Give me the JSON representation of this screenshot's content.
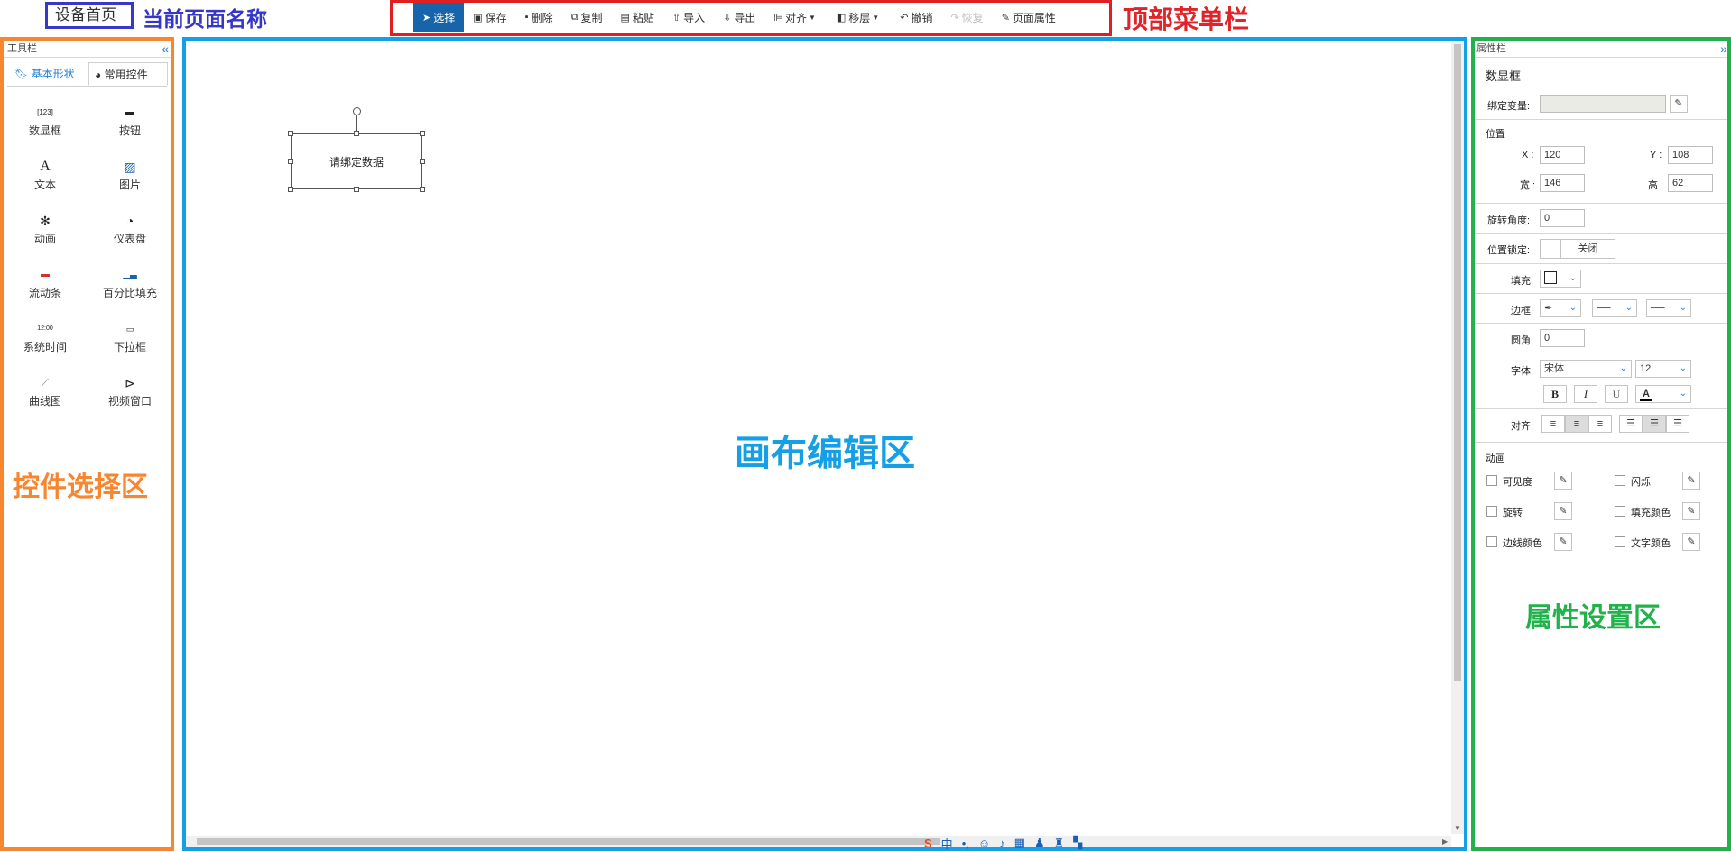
{
  "page": {
    "name": "设备首页"
  },
  "annotations": {
    "page_name": "当前页面名称",
    "top_menu": "顶部菜单栏",
    "control_area": "控件选择区",
    "canvas_area": "画布编辑区",
    "property_area": "属性设置区"
  },
  "menu": {
    "items": [
      {
        "label": "选择",
        "icon": "cursor-icon"
      },
      {
        "label": "保存",
        "icon": "save-icon"
      },
      {
        "label": "删除",
        "icon": "trash-icon"
      },
      {
        "label": "复制",
        "icon": "copy-icon"
      },
      {
        "label": "粘贴",
        "icon": "paste-icon"
      },
      {
        "label": "导入",
        "icon": "upload-icon"
      },
      {
        "label": "导出",
        "icon": "download-icon"
      },
      {
        "label": "对齐",
        "icon": "align-icon"
      },
      {
        "label": "移层",
        "icon": "layers-icon"
      },
      {
        "label": "撤销",
        "icon": "undo-icon"
      },
      {
        "label": "恢复",
        "icon": "redo-icon"
      },
      {
        "label": "页面属性",
        "icon": "wrench-icon"
      }
    ]
  },
  "toolbar": {
    "title": "工具栏",
    "tabs": [
      "基本形状",
      "常用控件"
    ],
    "tools": [
      {
        "label": "数显框",
        "icon": "numeric-display-icon"
      },
      {
        "label": "按钮",
        "icon": "button-icon"
      },
      {
        "label": "文本",
        "icon": "text-icon"
      },
      {
        "label": "图片",
        "icon": "image-icon"
      },
      {
        "label": "动画",
        "icon": "animation-icon"
      },
      {
        "label": "仪表盘",
        "icon": "gauge-icon"
      },
      {
        "label": "流动条",
        "icon": "flow-bar-icon"
      },
      {
        "label": "百分比填充",
        "icon": "percent-fill-icon"
      },
      {
        "label": "系统时间",
        "icon": "clock-icon"
      },
      {
        "label": "下拉框",
        "icon": "dropdown-icon"
      },
      {
        "label": "曲线图",
        "icon": "line-chart-icon"
      },
      {
        "label": "视频窗口",
        "icon": "video-icon"
      }
    ]
  },
  "canvas": {
    "shape_text": "请绑定数据"
  },
  "properties": {
    "title": "属性栏",
    "element_type": "数显框",
    "bind_var_label": "绑定变量:",
    "position_label": "位置",
    "x_label": "X :",
    "x_value": "120",
    "y_label": "Y :",
    "y_value": "108",
    "w_label": "宽 :",
    "w_value": "146",
    "h_label": "高 :",
    "h_value": "62",
    "rotation_label": "旋转角度:",
    "rotation_value": "0",
    "lock_label": "位置锁定:",
    "lock_value": "关闭",
    "fill_label": "填充:",
    "border_label": "边框:",
    "radius_label": "圆角:",
    "radius_value": "0",
    "font_label": "字体:",
    "font_value": "宋体",
    "font_size": "12",
    "bold": "B",
    "italic": "I",
    "underline": "U",
    "font_color_glyph": "A",
    "align_label": "对齐:",
    "animation_label": "动画",
    "animations": [
      "可见度",
      "闪烁",
      "旋转",
      "填充颜色",
      "边线颜色",
      "文字颜色"
    ]
  },
  "colors": {
    "accent": "#1864ab",
    "link_blue": "#1e7fd0",
    "anno_page": "#3535c8",
    "anno_menu": "#e0242a",
    "anno_left": "#f7862f",
    "anno_canvas": "#159fe5",
    "anno_right": "#21b24b"
  }
}
